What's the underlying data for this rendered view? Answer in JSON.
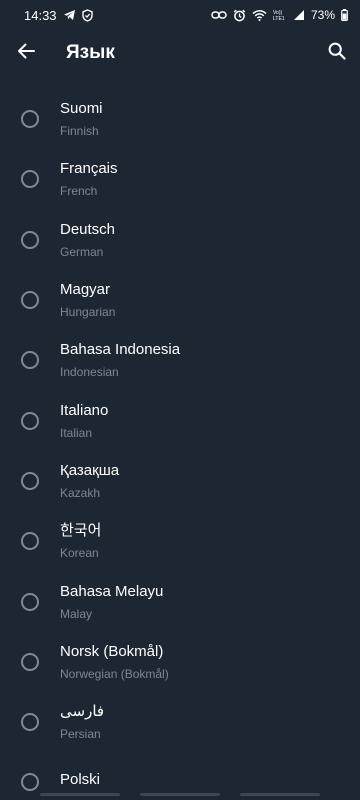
{
  "status_bar": {
    "time": "14:33",
    "left_icons": [
      "telegram-icon",
      "shield-icon"
    ],
    "right_icons": [
      "link-icon",
      "alarm-icon",
      "wifi-icon",
      "volte-icon",
      "signal-icon"
    ],
    "volte_label": "Vo))\nLTE1",
    "battery": "73%"
  },
  "header": {
    "title": "Язык",
    "back_icon": "arrow-left-icon",
    "search_icon": "search-icon"
  },
  "languages": [
    {
      "name": "Suomi",
      "sub": "Finnish"
    },
    {
      "name": "Français",
      "sub": "French"
    },
    {
      "name": "Deutsch",
      "sub": "German"
    },
    {
      "name": "Magyar",
      "sub": "Hungarian"
    },
    {
      "name": "Bahasa Indonesia",
      "sub": "Indonesian"
    },
    {
      "name": "Italiano",
      "sub": "Italian"
    },
    {
      "name": "Қазақша",
      "sub": "Kazakh"
    },
    {
      "name": "한국어",
      "sub": "Korean"
    },
    {
      "name": "Bahasa Melayu",
      "sub": "Malay"
    },
    {
      "name": "Norsk (Bokmål)",
      "sub": "Norwegian (Bokmål)"
    },
    {
      "name": "فارسی",
      "sub": "Persian"
    },
    {
      "name": "Polski",
      "sub": ""
    }
  ],
  "colors": {
    "background": "#1d2733",
    "primary_text": "#ffffff",
    "secondary_text": "#7d8893",
    "radio_border": "#7f8a96"
  }
}
